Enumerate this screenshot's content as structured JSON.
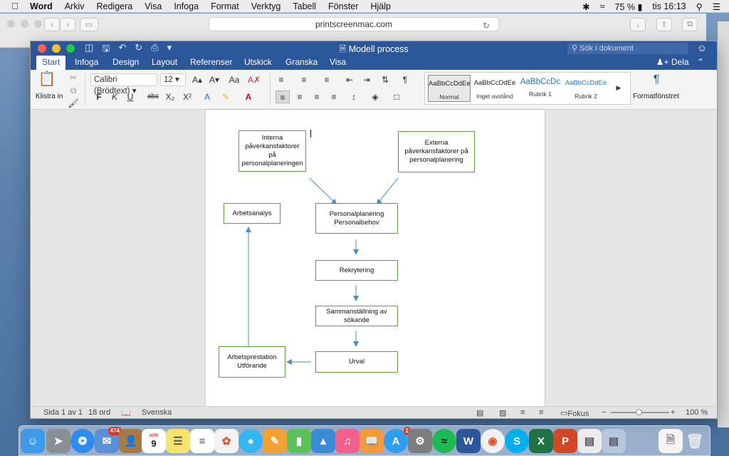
{
  "menubar": {
    "apple_icon": "apple-icon",
    "items": [
      "Word",
      "Arkiv",
      "Redigera",
      "Visa",
      "Infoga",
      "Format",
      "Verktyg",
      "Tabell",
      "Fönster",
      "Hjälp"
    ],
    "battery": "75 %",
    "clock": "tis 16:13"
  },
  "safari": {
    "url": "printscreenmac.com"
  },
  "word": {
    "title": "Modell process",
    "search_placeholder": "Sök i dokument",
    "tabs": [
      "Start",
      "Infoga",
      "Design",
      "Layout",
      "Referenser",
      "Utskick",
      "Granska",
      "Visa"
    ],
    "active_tab": "Start",
    "share_label": "Dela",
    "ribbon": {
      "paste_label": "Klistra in",
      "font_name": "Calibri (Brödtext)",
      "font_size": "12",
      "bold": "F",
      "italic": "K",
      "underline": "U",
      "strike": "abc",
      "subscript": "X₂",
      "superscript": "X²",
      "styles": [
        {
          "sample": "AaBbCcDdEe",
          "name": "Normal"
        },
        {
          "sample": "AaBbCcDdEe",
          "name": "Inget avstånd"
        },
        {
          "sample": "AaBbCcDc",
          "name": "Rubrik 1"
        },
        {
          "sample": "AaBbCcDdEe",
          "name": "Rubrik 2"
        }
      ],
      "format_pane_label": "Formatfönstret"
    },
    "flowchart": {
      "internal": "Interna påverkansfaktorer på personalplaneringen",
      "external": "Externa påverkansfaktorer på personalplanering",
      "job_analysis": "Arbetsanalys",
      "planning": "Personalplanering Personalbehov",
      "recruitment": "Rekrytering",
      "compilation": "Sammanställning av sökande",
      "selection": "Urval",
      "performance": "Arbetsprestation Utförande"
    },
    "status": {
      "page": "Sida 1 av 1",
      "words": "18 ord",
      "language": "Svenska",
      "focus": "Fokus",
      "zoom": "100 %"
    }
  },
  "dock": {
    "mail_badge": "474",
    "appstore_badge": "2",
    "calendar_month": "APR",
    "calendar_day": "9"
  },
  "colors": {
    "word_blue": "#2b579a",
    "flow_border": "#5aa03a",
    "arrow": "#4a90c0"
  }
}
